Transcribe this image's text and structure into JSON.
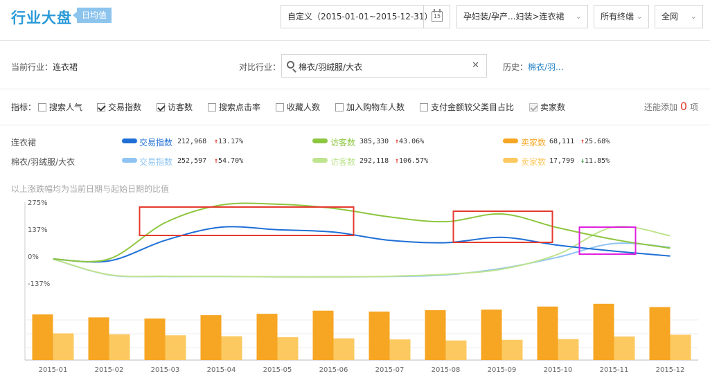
{
  "header": {
    "title": "行业大盘",
    "badge": "日均值",
    "date_range": "自定义（2015-01-01~2015-12-31）",
    "calendar_day": "15",
    "category": "孕妇装/孕产...妇装>连衣裙",
    "terminal": "所有终端",
    "network": "全网"
  },
  "industry": {
    "current_label": "当前行业：",
    "current_value": "连衣裙",
    "compare_label": "对比行业：",
    "compare_value": "棉衣/羽绒服/大衣",
    "history_label": "历史：",
    "history_value": "棉衣/羽..."
  },
  "indicators": {
    "label": "指标：",
    "items": [
      {
        "label": "搜索人气",
        "checked": false,
        "disabled": false
      },
      {
        "label": "交易指数",
        "checked": true,
        "disabled": false
      },
      {
        "label": "访客数",
        "checked": true,
        "disabled": false
      },
      {
        "label": "搜索点击率",
        "checked": false,
        "disabled": false
      },
      {
        "label": "收藏人数",
        "checked": false,
        "disabled": false
      },
      {
        "label": "加入购物车人数",
        "checked": false,
        "disabled": false
      },
      {
        "label": "支付金额较父类目占比",
        "checked": false,
        "disabled": false
      },
      {
        "label": "卖家数",
        "checked": true,
        "disabled": true
      }
    ],
    "remain_prefix": "还能添加",
    "remain_count": "0",
    "remain_suffix": "项"
  },
  "metrics": {
    "rows": [
      {
        "name": "连衣裙",
        "items": [
          {
            "label": "交易指数",
            "value": "212,968",
            "dir": "up",
            "change": "13.17%",
            "color": "#1f6fd6"
          },
          {
            "label": "访客数",
            "value": "385,330",
            "dir": "up",
            "change": "43.06%",
            "color": "#8dc63f"
          },
          {
            "label": "卖家数",
            "value": "68,111",
            "dir": "up",
            "change": "25.68%",
            "color": "#f6a623"
          }
        ]
      },
      {
        "name": "棉衣/羽绒服/大衣",
        "items": [
          {
            "label": "交易指数",
            "value": "252,597",
            "dir": "up",
            "change": "54.70%",
            "color": "#8fc4f2"
          },
          {
            "label": "访客数",
            "value": "292,118",
            "dir": "up",
            "change": "106.57%",
            "color": "#bfe38e"
          },
          {
            "label": "卖家数",
            "value": "17,799",
            "dir": "down",
            "change": "11.85%",
            "color": "#fcc961"
          }
        ]
      }
    ]
  },
  "note": "以上涨跌幅均为当前日期与起始日期的比值",
  "chart_data": {
    "type": "line",
    "x": [
      "2015-01",
      "2015-02",
      "2015-03",
      "2015-04",
      "2015-05",
      "2015-06",
      "2015-07",
      "2015-08",
      "2015-09",
      "2015-10",
      "2015-11",
      "2015-12"
    ],
    "y_ticks": [
      "275%",
      "137%",
      "0%",
      "-137%"
    ],
    "ylim": [
      -137,
      275
    ],
    "series": [
      {
        "name": "连衣裙 交易指数",
        "color": "#1f6fd6",
        "values": [
          0,
          -10,
          95,
          162,
          149,
          137,
          95,
          83,
          110,
          70,
          40,
          15
        ]
      },
      {
        "name": "连衣裙 访客数",
        "color": "#8dc63f",
        "values": [
          0,
          0,
          185,
          275,
          279,
          258,
          214,
          190,
          229,
          159,
          99,
          55
        ]
      },
      {
        "name": "棉衣/羽绒服/大衣 交易指数",
        "color": "#8fc4f2",
        "values": [
          0,
          -81,
          -89,
          -89,
          -91,
          -91,
          -89,
          -81,
          -48,
          9,
          79,
          59
        ]
      },
      {
        "name": "棉衣/羽绒服/大衣 访客数",
        "color": "#bfe38e",
        "values": [
          0,
          -80,
          -88,
          -89,
          -91,
          -91,
          -88,
          -78,
          -52,
          24,
          163,
          118
        ]
      }
    ],
    "bars": [
      {
        "name": "连衣裙 卖家数",
        "color": "#f6a623",
        "values": [
          58600,
          54800,
          53400,
          57700,
          59400,
          63400,
          62300,
          64100,
          64800,
          68700,
          72200,
          68100
        ]
      },
      {
        "name": "棉衣/羽绒服/大衣 卖家数",
        "color": "#fcc961",
        "values": [
          34300,
          33100,
          31800,
          30600,
          29300,
          27900,
          26500,
          25200,
          26000,
          26900,
          30300,
          32500
        ]
      }
    ],
    "highlight_boxes": [
      {
        "color": "#e53a2e",
        "from": "2015-03",
        "to": "2015-06"
      },
      {
        "color": "#e53a2e",
        "from": "2015-08",
        "to": "2015-09"
      },
      {
        "color": "#e020e0",
        "from": "2015-10",
        "to": "2015-11"
      }
    ]
  }
}
